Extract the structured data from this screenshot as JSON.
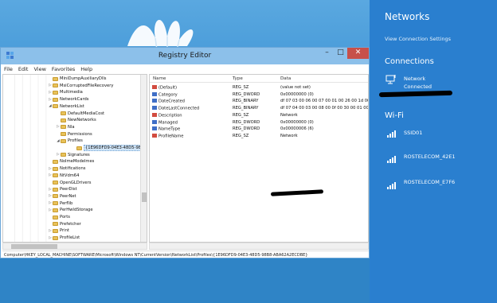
{
  "registry": {
    "title": "Registry Editor",
    "window_controls": [
      "–",
      "□",
      "✕"
    ],
    "menu": [
      "File",
      "Edit",
      "View",
      "Favorites",
      "Help"
    ],
    "tree": [
      {
        "label": "MiniDumpAuxiliaryDlls",
        "expander": "",
        "sel": false
      },
      {
        "label": "MsiCorruptedFileRecovery",
        "expander": "▷",
        "sel": false
      },
      {
        "label": "Multimedia",
        "expander": "▷",
        "sel": false
      },
      {
        "label": "NetworkCards",
        "expander": "▷",
        "sel": false
      },
      {
        "label": "NetworkList",
        "expander": "◢",
        "sel": false
      },
      {
        "label": "DefaultMediaCost",
        "expander": "",
        "sel": false
      },
      {
        "label": "NewNetworks",
        "expander": "",
        "sel": false
      },
      {
        "label": "Nla",
        "expander": "▷",
        "sel": false
      },
      {
        "label": "Permissions",
        "expander": "",
        "sel": false
      },
      {
        "label": "Profiles",
        "expander": "◢",
        "sel": false
      },
      {
        "label": "{1E96DFD9-04E3-48D5-98B",
        "expander": "",
        "sel": true
      },
      {
        "label": "Signatures",
        "expander": "▷",
        "sel": false
      },
      {
        "label": "NoImeModelmes",
        "expander": "",
        "sel": false
      },
      {
        "label": "Notifications",
        "expander": "▷",
        "sel": false
      },
      {
        "label": "NtVdm64",
        "expander": "▷",
        "sel": false
      },
      {
        "label": "OpenGLDrivers",
        "expander": "",
        "sel": false
      },
      {
        "label": "PeerDist",
        "expander": "▷",
        "sel": false
      },
      {
        "label": "PeerNet",
        "expander": "▷",
        "sel": false
      },
      {
        "label": "Perflib",
        "expander": "▷",
        "sel": false
      },
      {
        "label": "PerHwIdStorage",
        "expander": "▷",
        "sel": false
      },
      {
        "label": "Ports",
        "expander": "",
        "sel": false
      },
      {
        "label": "Prefetcher",
        "expander": "",
        "sel": false
      },
      {
        "label": "Print",
        "expander": "▷",
        "sel": false
      },
      {
        "label": "ProfileList",
        "expander": "▷",
        "sel": false
      }
    ],
    "columns": [
      "Name",
      "Type",
      "Data"
    ],
    "values": [
      {
        "name": "(Default)",
        "type": "REG_SZ",
        "data": "(value not set)",
        "kind": "sz"
      },
      {
        "name": "Category",
        "type": "REG_DWORD",
        "data": "0x00000000 (0)",
        "kind": "bin"
      },
      {
        "name": "DateCreated",
        "type": "REG_BINARY",
        "data": "df 07 03 00 06 00 07 00 01 00 26 00 1d 00 83 0",
        "kind": "bin"
      },
      {
        "name": "DateLastConnected",
        "type": "REG_BINARY",
        "data": "df 07 04 00 03 00 08 00 0f 00 30 00 01 00 65 0",
        "kind": "bin"
      },
      {
        "name": "Description",
        "type": "REG_SZ",
        "data": "Network",
        "kind": "sz"
      },
      {
        "name": "Managed",
        "type": "REG_DWORD",
        "data": "0x00000000 (0)",
        "kind": "bin"
      },
      {
        "name": "NameType",
        "type": "REG_DWORD",
        "data": "0x00000006 (6)",
        "kind": "bin"
      },
      {
        "name": "ProfileName",
        "type": "REG_SZ",
        "data": "Network",
        "kind": "sz"
      }
    ],
    "status_path": "Computer\\HKEY_LOCAL_MACHINE\\SOFTWARE\\Microsoft\\Windows NT\\CurrentVersion\\NetworkList\\Profiles\\{1E96DFD9-04E3-48D5-98B8-ABA62A2ECDBE}"
  },
  "charm": {
    "title": "Networks",
    "settings_link": "View Connection Settings",
    "connections_heading": "Connections",
    "connection": {
      "name": "Network",
      "status": "Connected"
    },
    "wifi_heading": "Wi-Fi",
    "wifi_networks": [
      "SSID01",
      "ROSTELECOM_42E1",
      "ROSTELECOM_E7F6"
    ]
  }
}
